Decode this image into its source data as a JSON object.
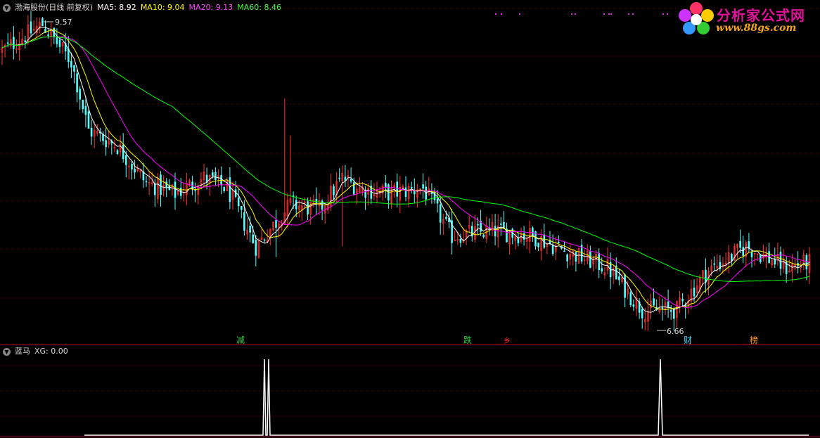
{
  "header_main": {
    "toggle_icon": "chevron-down-icon",
    "title": "渤海股份(日线 前复权)",
    "ma5": "MA5: 8.92",
    "ma10": "MA10: 9.04",
    "ma20": "MA20: 9.13",
    "ma60": "MA60: 8.46"
  },
  "header_sub": {
    "toggle_icon": "chevron-down-icon",
    "title": "蓝马",
    "value": "XG: 0.00"
  },
  "logo": {
    "icon": "flower-logo-icon",
    "title": "分析家公式网",
    "url": "www.88gs.com"
  },
  "colors": {
    "up_candle": "#ff3232",
    "down_candle": "#54ffff",
    "ma5": "#ffffff",
    "ma10": "#ffff00",
    "ma20": "#ff00ff",
    "ma60": "#00ff00",
    "grid": "#7a0000",
    "divider": "#b00000"
  },
  "chart_data": [
    {
      "type": "candlestick",
      "title": "渤海股份(日线 前复权)",
      "indicators": [
        {
          "name": "MA5",
          "last": 8.92,
          "color": "#ffffff"
        },
        {
          "name": "MA10",
          "last": 9.04,
          "color": "#ffff00"
        },
        {
          "name": "MA20",
          "last": 9.13,
          "color": "#ff00ff"
        },
        {
          "name": "MA60",
          "last": 8.46,
          "color": "#00ff00"
        }
      ],
      "high_marker": {
        "label": "9.57",
        "value": 9.57
      },
      "low_marker": {
        "label": "6.66",
        "value": 6.66
      },
      "price_path_key": [
        {
          "bar": 0,
          "price": 9.3
        },
        {
          "bar": 14,
          "price": 9.55
        },
        {
          "bar": 24,
          "price": 9.2
        },
        {
          "bar": 30,
          "price": 8.55
        },
        {
          "bar": 40,
          "price": 8.4
        },
        {
          "bar": 50,
          "price": 8.05
        },
        {
          "bar": 60,
          "price": 7.95
        },
        {
          "bar": 70,
          "price": 8.1
        },
        {
          "bar": 78,
          "price": 8.0
        },
        {
          "bar": 88,
          "price": 7.45
        },
        {
          "bar": 100,
          "price": 7.85
        },
        {
          "bar": 110,
          "price": 7.8
        },
        {
          "bar": 118,
          "price": 8.1
        },
        {
          "bar": 124,
          "price": 8.0
        },
        {
          "bar": 134,
          "price": 7.95
        },
        {
          "bar": 146,
          "price": 8.0
        },
        {
          "bar": 156,
          "price": 7.55
        },
        {
          "bar": 170,
          "price": 7.6
        },
        {
          "bar": 184,
          "price": 7.55
        },
        {
          "bar": 196,
          "price": 7.4
        },
        {
          "bar": 210,
          "price": 7.25
        },
        {
          "bar": 222,
          "price": 6.85
        },
        {
          "bar": 234,
          "price": 6.85
        },
        {
          "bar": 244,
          "price": 7.2
        },
        {
          "bar": 258,
          "price": 7.45
        },
        {
          "bar": 272,
          "price": 7.25
        },
        {
          "bar": 280,
          "price": 7.3
        }
      ],
      "signal_labels": [
        {
          "text": "减",
          "color": "#2ecc40"
        },
        {
          "text": "跌",
          "color": "#2ecc40"
        },
        {
          "text": "乡",
          "color": "#ff2020"
        },
        {
          "text": "财",
          "color": "#44ddff"
        },
        {
          "text": "榜",
          "color": "#ff9922"
        }
      ],
      "top_dots": [
        {
          "color": "#dd22dd"
        },
        {
          "color": "#dd22dd"
        },
        {
          "color": "#dd22dd"
        },
        {
          "color": "#dd22dd"
        },
        {
          "color": "#dd22dd"
        },
        {
          "color": "#dd22dd"
        },
        {
          "color": "#dd22dd"
        },
        {
          "color": "#dd22dd"
        },
        {
          "color": "#dd22dd"
        },
        {
          "color": "#dd22dd"
        },
        {
          "color": "#dd22dd"
        },
        {
          "color": "#dd22dd"
        }
      ]
    },
    {
      "type": "line",
      "title": "蓝马",
      "series": [
        {
          "name": "XG",
          "last": 0.0,
          "color": "#ffffff"
        }
      ],
      "ylim": [
        0,
        1
      ],
      "spikes": [
        {
          "x_from": 374,
          "x_to": 378,
          "x_peak": 376
        },
        {
          "x_from": 380,
          "x_to": 384,
          "x_peak": 382
        },
        {
          "x_from": 936,
          "x_to": 942,
          "x_peak": 939
        }
      ]
    }
  ]
}
